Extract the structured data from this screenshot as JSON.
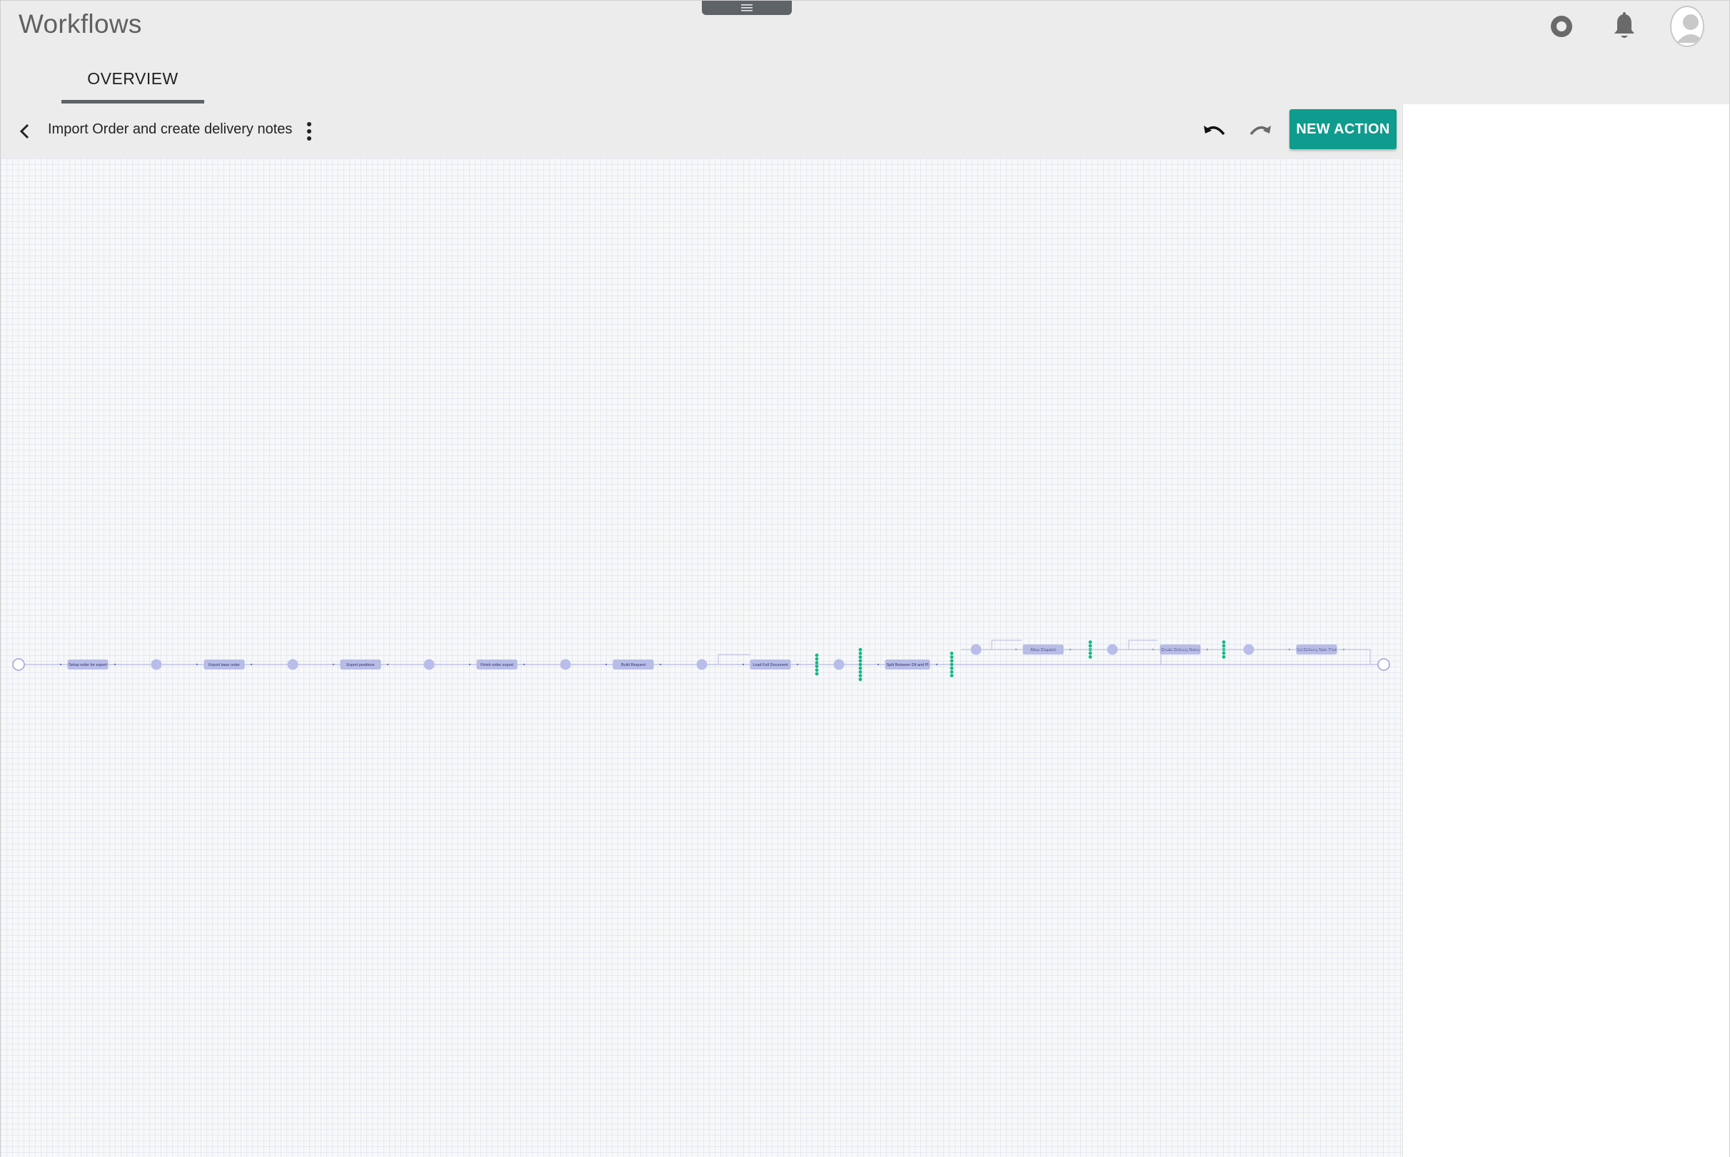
{
  "app": {
    "title": "Workflows"
  },
  "header": {
    "icons": [
      "help-circle-icon",
      "bell-icon",
      "user-avatar-icon"
    ]
  },
  "tabs": [
    {
      "label": "OVERVIEW",
      "active": true
    }
  ],
  "toolbar": {
    "workflow_name": "Import Order and create delivery notes",
    "new_action_label": "NEW ACTION"
  },
  "colors": {
    "accent": "#0f9b8e",
    "node_fill": "#b8bde8",
    "port": "#12b886",
    "tab_indicator": "#5d6367"
  },
  "workflow": {
    "nodes": [
      "Setup order for export",
      "Export base order",
      "Export positions",
      "Finish order export",
      "Build Request",
      "Load Full Document",
      "Split Between Dlt and Pl",
      "Allow Dispatch",
      "Create Delivery Notes",
      "Set Delivery Note Print"
    ]
  }
}
